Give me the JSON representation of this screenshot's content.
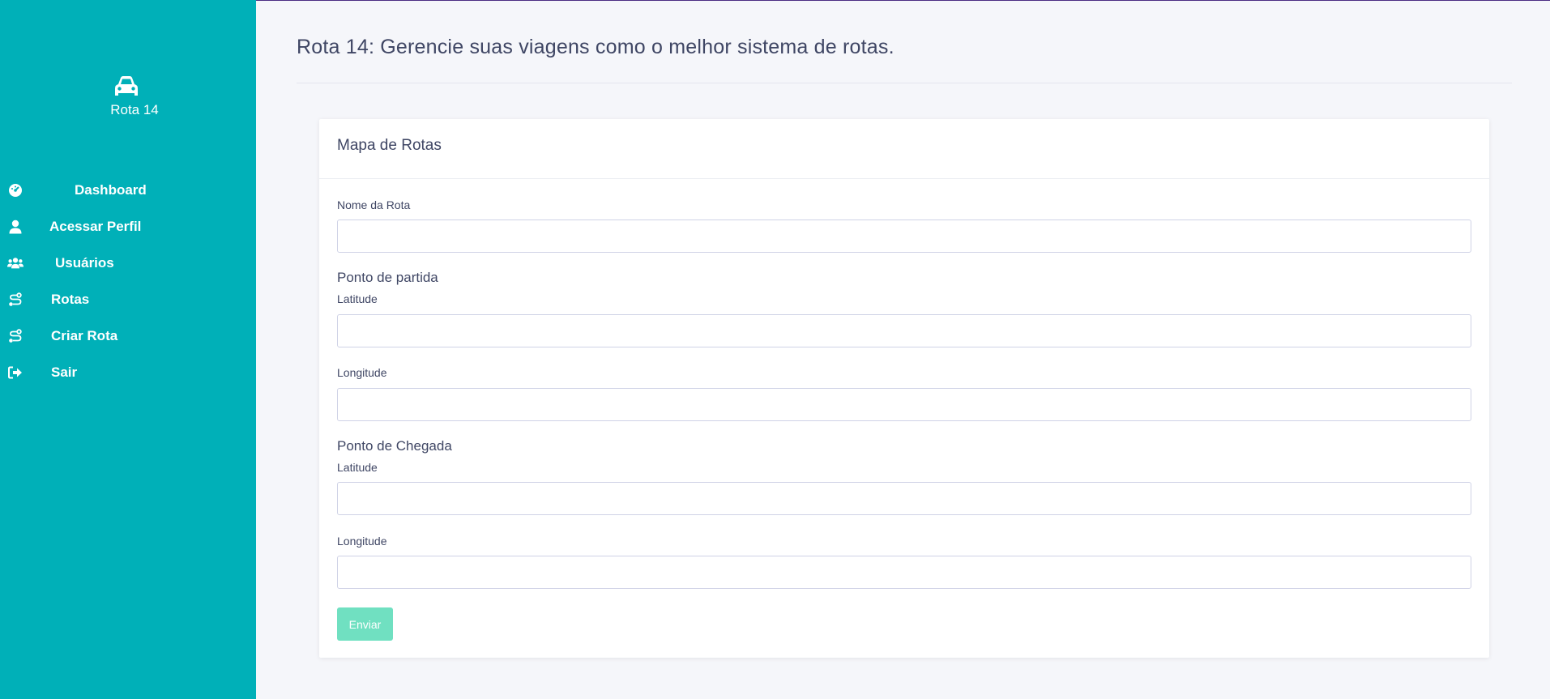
{
  "sidebar": {
    "brand": {
      "icon": "car-icon",
      "name": "Rota 14"
    },
    "items": [
      {
        "label": "Dashboard",
        "icon": "dashboard-icon"
      },
      {
        "label": "Acessar Perfil",
        "icon": "user-icon"
      },
      {
        "label": "Usuários",
        "icon": "users-icon"
      },
      {
        "label": "Rotas",
        "icon": "route-icon"
      },
      {
        "label": "Criar Rota",
        "icon": "route-icon"
      },
      {
        "label": "Sair",
        "icon": "sign-out-icon"
      }
    ],
    "bg_color": "#00b0b8"
  },
  "header": {
    "title": "Rota 14: Gerencie suas viagens como o melhor sistema de rotas."
  },
  "card": {
    "title": "Mapa de Rotas",
    "route_name_label": "Nome da Rota",
    "route_name_value": "",
    "start": {
      "title": "Ponto de partida",
      "lat_label": "Latitude",
      "lat_value": "",
      "lng_label": "Longitude",
      "lng_value": ""
    },
    "end": {
      "title": "Ponto de Chegada",
      "lat_label": "Latitude",
      "lat_value": "",
      "lng_label": "Longitude",
      "lng_value": ""
    },
    "submit_label": "Enviar",
    "submit_color": "#70e0c1"
  }
}
